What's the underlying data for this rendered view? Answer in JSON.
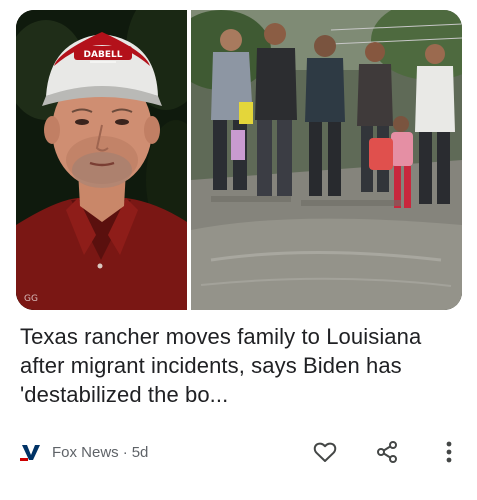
{
  "article": {
    "headline": "Texas rancher moves family to Louisiana after migrant incidents, says Biden has 'destabilized the bo...",
    "source_name": "Fox News",
    "separator": "·",
    "age": "5d",
    "image_left_watermark": "GG",
    "hat_text": "DABELL"
  },
  "icons": {
    "like": "heart-outline-icon",
    "share": "share-icon",
    "more": "more-vertical-icon",
    "source_logo": "fox-news-logo-icon"
  },
  "colors": {
    "headline": "#202124",
    "meta": "#5f6368",
    "icon": "#444746",
    "fox_blue": "#003366",
    "fox_red": "#cc0000"
  }
}
